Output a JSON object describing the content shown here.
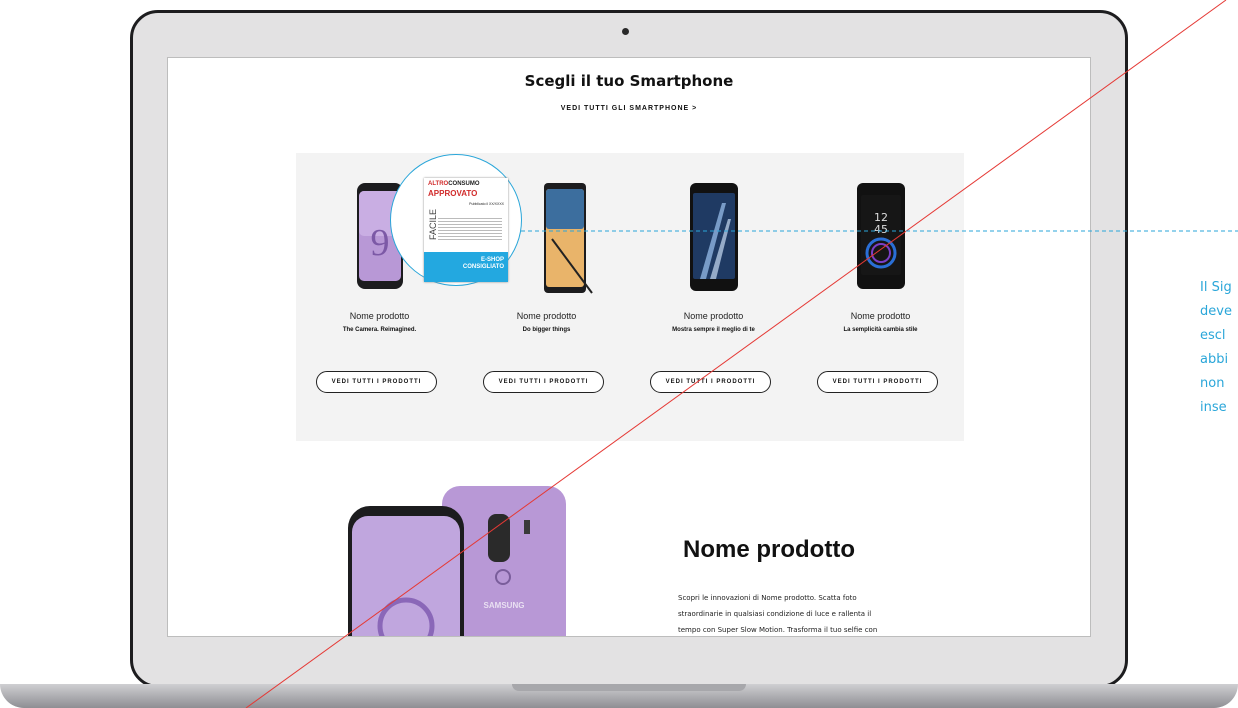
{
  "section": {
    "title": "Scegli il tuo Smartphone",
    "see_all": "VEDI TUTTI GLI SMARTPHONE >"
  },
  "products": [
    {
      "name": "Nome prodotto",
      "tagline": "The Camera. Reimagined.",
      "button": "VEDI TUTTI I PRODOTTI"
    },
    {
      "name": "Nome prodotto",
      "tagline": "Do bigger things",
      "button": "VEDI TUTTI I PRODOTTI"
    },
    {
      "name": "Nome prodotto",
      "tagline": "Mostra sempre il meglio di te",
      "button": "VEDI TUTTI I PRODOTTI"
    },
    {
      "name": "Nome prodotto",
      "tagline": "La semplicità cambia stile",
      "button": "VEDI TUTTI I PRODOTTI"
    }
  ],
  "badge": {
    "brand_prefix": "ALTRO",
    "brand_suffix": "CONSUMO",
    "status": "APPROVATO",
    "published": "Pubblicato il XX/XXXX",
    "side_text": "FACILE",
    "footer_line1": "E-SHOP",
    "footer_line2": "CONSIGLIATO"
  },
  "phone_screen_text": {
    "hour": "12",
    "minute": "45",
    "nine": "9"
  },
  "hero": {
    "name": "Nome prodotto",
    "brand": "SAMSUNG",
    "description_lines": [
      "Scopri le innovazioni di Nome prodotto. Scatta foto",
      "straordinarie in qualsiasi condizione di luce e rallenta il",
      "tempo con Super Slow Motion. Trasforma il tuo selfie con"
    ]
  },
  "side_note_lines": [
    "Il Sig",
    "deve",
    "escl",
    "abbi",
    "non",
    "inse"
  ],
  "colors": {
    "accent_blue": "#2aa6d9",
    "annotation_red": "#e53935",
    "badge_red": "#d12b2b",
    "badge_blue": "#23a8e0",
    "phone_purple": "#b898d6"
  }
}
